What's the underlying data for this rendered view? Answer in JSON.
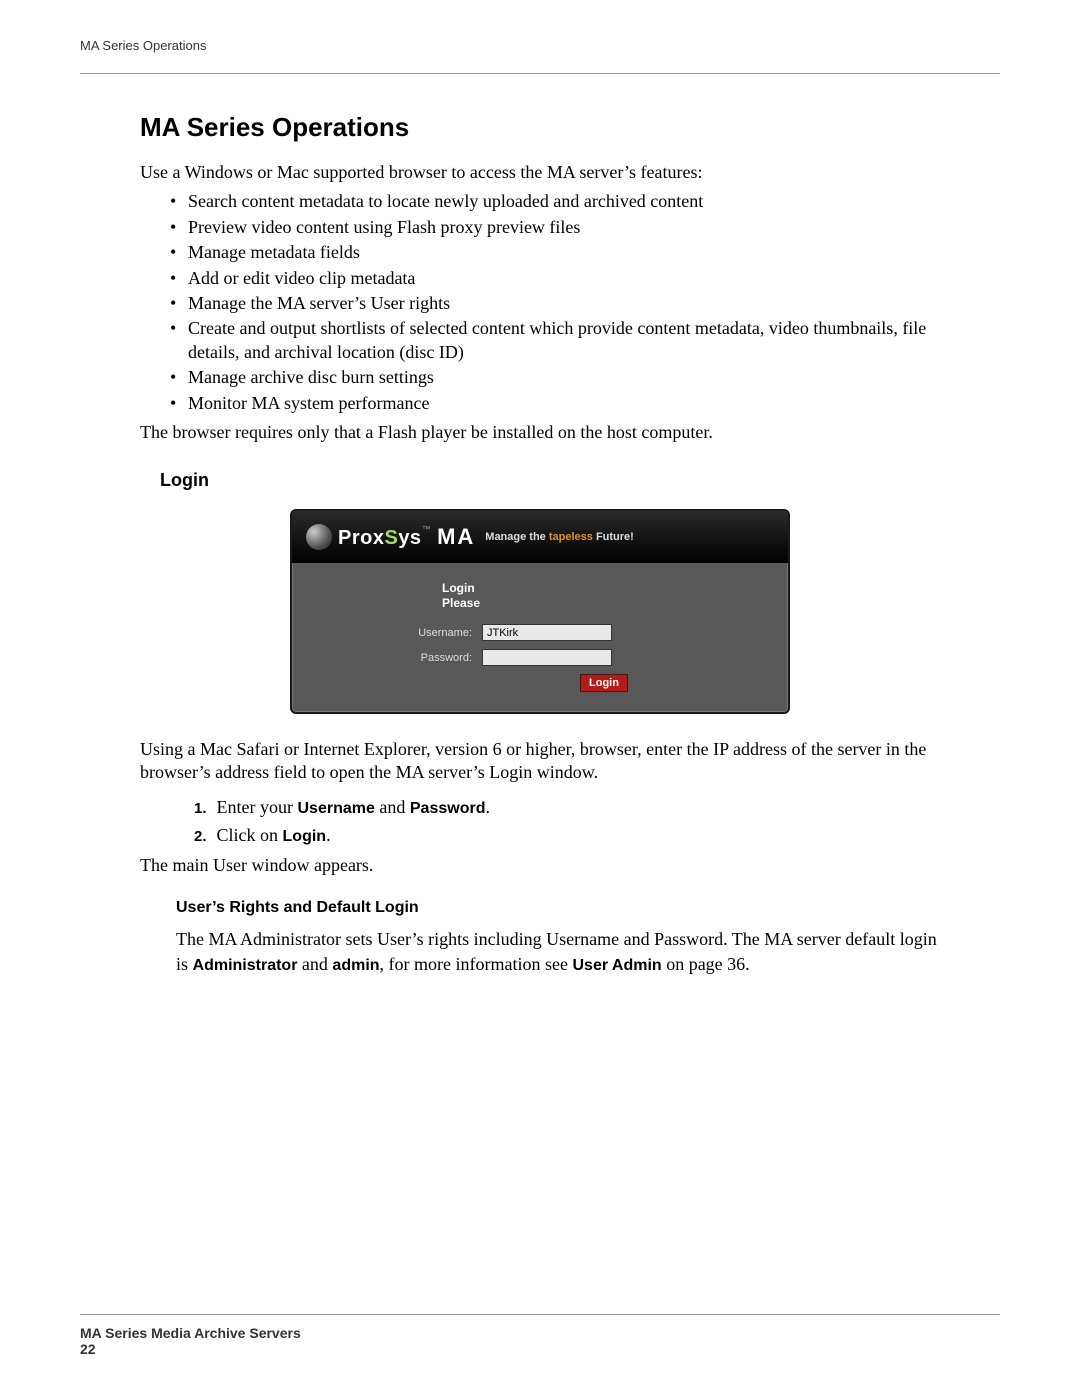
{
  "header": {
    "running": "MA Series Operations"
  },
  "title": "MA Series Operations",
  "intro": "Use a Windows or Mac supported browser to access the MA server’s features:",
  "bullets": [
    "Search content metadata to locate newly uploaded and archived content",
    "Preview video content using Flash proxy preview files",
    "Manage metadata fields",
    "Add or edit video clip metadata",
    "Manage the MA server’s User rights",
    "Create and output shortlists of selected content which provide content metadata, video thumbnails, file details, and archival location (disc ID)",
    "Manage archive disc burn settings",
    "Monitor MA system performance"
  ],
  "after_bullets": "The browser requires only that a Flash player be installed on the host computer.",
  "login": {
    "heading": "Login",
    "logo_prox": "Prox",
    "logo_s": "S",
    "logo_ys": "ys",
    "logo_tm": "™",
    "logo_ma": "MA",
    "tagline_pre": "Manage the ",
    "tagline_em": "tapeless",
    "tagline_post": " Future!",
    "panel_title1": "Login",
    "panel_title2": "Please",
    "username_label": "Username:",
    "username_value": "JTKirk",
    "password_label": "Password:",
    "password_value": "",
    "button": "Login"
  },
  "after_login": "Using a Mac Safari or Internet Explorer, version 6 or higher, browser, enter the IP address of the server in the browser’s address field to open the MA server’s Login window.",
  "steps": {
    "s1_num": "1.",
    "s1_a": "Enter your ",
    "s1_b": "Username",
    "s1_c": " and ",
    "s1_d": "Password",
    "s1_e": ".",
    "s2_num": "2.",
    "s2_a": "Click on ",
    "s2_b": "Login",
    "s2_c": "."
  },
  "after_steps": "The main User window appears.",
  "rights": {
    "heading": "User’s Rights and Default Login",
    "p_a": "The MA Administrator sets User’s rights including Username and Password. The MA server default login is ",
    "p_b": "Administrator",
    "p_c": " and ",
    "p_d": "admin",
    "p_e": ", for more information see ",
    "p_f": "User Admin",
    "p_g": " on page 36."
  },
  "footer": {
    "title": "MA Series Media Archive Servers",
    "page": "22"
  }
}
